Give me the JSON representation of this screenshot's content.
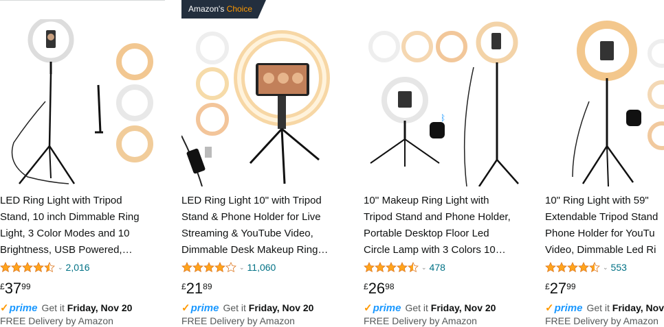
{
  "colors": {
    "star": "#ffa41c",
    "link": "#007185",
    "prime": "#1a98ff",
    "badge_bg": "#232f3e",
    "badge_accent": "#ff9900"
  },
  "products": [
    {
      "title_lines": [
        "LED Ring Light with Tripod",
        "Stand, 10 inch Dimmable Ring",
        "Light, 3 Color Modes and 10",
        "Brightness, USB Powered,…"
      ],
      "rating": 4.5,
      "review_count": "2,016",
      "price": {
        "symbol": "£",
        "whole": "37",
        "fraction": "99"
      },
      "prime_label": "prime",
      "delivery_prefix": "Get it",
      "delivery_date": "Friday, Nov 20",
      "free_delivery": "FREE Delivery by Amazon"
    },
    {
      "badge": {
        "text": "Amazon's",
        "accent": "Choice"
      },
      "title_lines": [
        "LED Ring Light 10\" with Tripod",
        "Stand & Phone Holder for Live",
        "Streaming & YouTube Video,",
        "Dimmable Desk Makeup Ring…"
      ],
      "rating": 4.0,
      "review_count": "11,060",
      "price": {
        "symbol": "£",
        "whole": "21",
        "fraction": "89"
      },
      "prime_label": "prime",
      "delivery_prefix": "Get it",
      "delivery_date": "Friday, Nov 20",
      "free_delivery": "FREE Delivery by Amazon"
    },
    {
      "title_lines": [
        "10'' Makeup Ring Light with",
        "Tripod Stand and Phone Holder,",
        "Portable Desktop Floor Led",
        "Circle Lamp with 3 Colors 10…"
      ],
      "rating": 4.5,
      "review_count": "478",
      "price": {
        "symbol": "£",
        "whole": "26",
        "fraction": "98"
      },
      "prime_label": "prime",
      "delivery_prefix": "Get it",
      "delivery_date": "Friday, Nov 20",
      "free_delivery": "FREE Delivery by Amazon"
    },
    {
      "title_lines": [
        "10\" Ring Light with 59\"",
        "Extendable Tripod Stand",
        "Phone Holder for YouTu",
        "Video, Dimmable Led Ri"
      ],
      "rating": 4.5,
      "review_count": "553",
      "price": {
        "symbol": "£",
        "whole": "27",
        "fraction": "99"
      },
      "prime_label": "prime",
      "delivery_prefix": "Get it",
      "delivery_date": "Friday, Nov",
      "free_delivery": "FREE Delivery by Amazon"
    }
  ]
}
